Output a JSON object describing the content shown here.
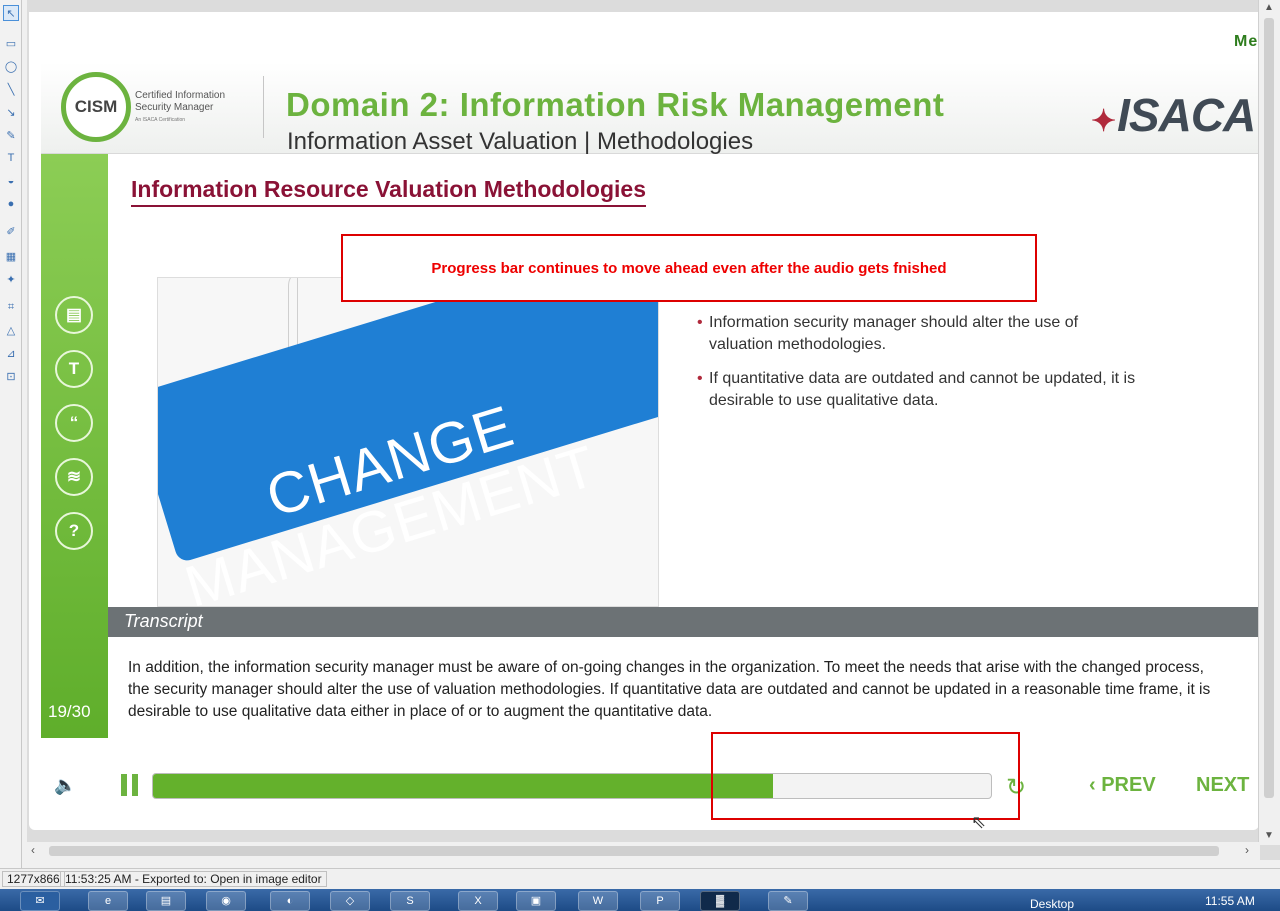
{
  "course": {
    "corner_link": "Me",
    "logo_badge": "CISM",
    "logo_line1": "Certified Information",
    "logo_line2": "Security Manager",
    "logo_line3": "An ISACA Certification",
    "domain_title": "Domain 2: Information Risk Management",
    "domain_subtitle": "Information Asset Valuation | Methodologies",
    "brand": "ISACA"
  },
  "rail": {
    "buttons": [
      {
        "name": "notes-icon",
        "glyph": "▤"
      },
      {
        "name": "text-icon",
        "glyph": "T"
      },
      {
        "name": "quote-icon",
        "glyph": "“"
      },
      {
        "name": "layers-icon",
        "glyph": "≋"
      },
      {
        "name": "help-icon",
        "glyph": "?"
      }
    ],
    "page_count": "19/30"
  },
  "slide": {
    "title": "Information Resource Valuation Methodologies",
    "image_text_line1": "CHANGE",
    "image_text_line2": "MANAGEMENT",
    "bullets": [
      "Information security manager should alter the use of valuation methodologies.",
      "If quantitative data are outdated and cannot be updated, it is desirable to use qualitative data."
    ],
    "callout": "Progress bar continues to move ahead even after the audio gets fnished"
  },
  "transcript": {
    "heading": "Transcript",
    "text": "In addition, the information security manager must be aware of on-going changes in the organization. To meet the needs that arise with the changed process, the security manager should alter the use of valuation methodologies. If quantitative data are outdated and cannot be updated in a reasonable time frame, it is desirable to use qualitative data either in place of or to augment the quantitative data."
  },
  "player": {
    "progress_percent": 74,
    "prev_label": "PREV",
    "next_label": "NEXT",
    "accent": "#6cb33f"
  },
  "statusbar": {
    "dimensions": "1277x866",
    "message": "11:53:25 AM - Exported to: Open in image editor"
  },
  "taskbar": {
    "desktop_label": "Desktop",
    "clock": "11:55 AM"
  }
}
